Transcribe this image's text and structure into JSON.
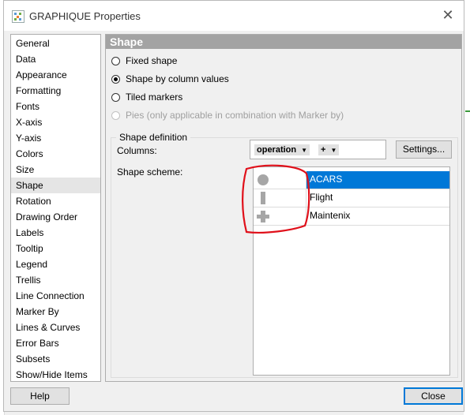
{
  "window": {
    "title": "GRAPHIQUE Properties",
    "close_glyph": "✕"
  },
  "nav": {
    "items": [
      {
        "label": "General"
      },
      {
        "label": "Data"
      },
      {
        "label": "Appearance"
      },
      {
        "label": "Formatting"
      },
      {
        "label": "Fonts"
      },
      {
        "label": "X-axis"
      },
      {
        "label": "Y-axis"
      },
      {
        "label": "Colors"
      },
      {
        "label": "Size"
      },
      {
        "label": "Shape",
        "selected": true
      },
      {
        "label": "Rotation"
      },
      {
        "label": "Drawing Order"
      },
      {
        "label": "Labels"
      },
      {
        "label": "Tooltip"
      },
      {
        "label": "Legend"
      },
      {
        "label": "Trellis"
      },
      {
        "label": "Line Connection"
      },
      {
        "label": "Marker By"
      },
      {
        "label": "Lines & Curves"
      },
      {
        "label": "Error Bars"
      },
      {
        "label": "Subsets"
      },
      {
        "label": "Show/Hide Items"
      }
    ]
  },
  "panel": {
    "title": "Shape",
    "options": {
      "fixed_shape": "Fixed shape",
      "by_column": "Shape by column values",
      "tiled": "Tiled markers",
      "pies": "Pies (only applicable in combination with Marker by)",
      "selected": "by_column"
    },
    "definition": {
      "group_label": "Shape definition",
      "columns_label": "Columns:",
      "column_chip": "operation",
      "chip_arrow": "▼",
      "plus_chip": "+",
      "settings_button": "Settings...",
      "scheme_label": "Shape scheme:"
    },
    "scheme": [
      {
        "name": "ACARS",
        "shape": "circle",
        "selected": true
      },
      {
        "name": "Flight",
        "shape": "bar"
      },
      {
        "name": "Maintenix",
        "shape": "plus"
      }
    ]
  },
  "footer": {
    "help_button": "Help",
    "close_button": "Close"
  },
  "colors": {
    "accent": "#0078d7",
    "annotation": "#e0101a",
    "shape_gray": "#a6a6a6"
  }
}
